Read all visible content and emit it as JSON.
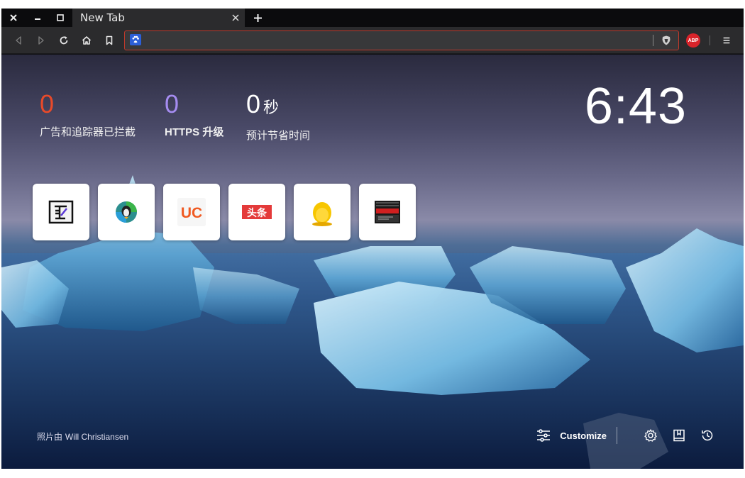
{
  "tab": {
    "title": "New Tab"
  },
  "toolbar": {
    "url_value": "",
    "abp_label": "ABP"
  },
  "stats": [
    {
      "value": "0",
      "unit": "",
      "label": "广告和追踪器已拦截",
      "color": "#e84a2a"
    },
    {
      "value": "0",
      "unit": "",
      "label": "HTTPS 升级",
      "color": "#a58cf0"
    },
    {
      "value": "0",
      "unit": "秒",
      "label": "预计节省时间",
      "color": "#ffffff"
    }
  ],
  "clock": {
    "time": "6:43"
  },
  "top_sites": [
    {
      "icon": "tieba-icon"
    },
    {
      "icon": "chrome-penguin-icon"
    },
    {
      "icon": "uc-icon",
      "text": "UC"
    },
    {
      "icon": "toutiao-icon",
      "text": "头条"
    },
    {
      "icon": "qq-penguin-icon"
    },
    {
      "icon": "video-icon"
    }
  ],
  "credit": {
    "prefix": "照片由",
    "name": "Will Christiansen"
  },
  "bottom": {
    "customize_label": "Customize"
  },
  "colors": {
    "accent": "#c0392b",
    "frame": "#0b0b0d",
    "toolbar": "#2b2b2d"
  }
}
